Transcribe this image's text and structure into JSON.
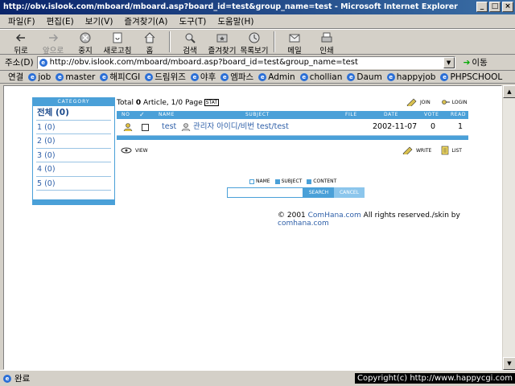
{
  "window": {
    "title": "http://obv.islook.com/mboard/mboard.asp?board_id=test&group_name=test - Microsoft Internet Explorer",
    "min": "_",
    "max": "□",
    "close": "×"
  },
  "menu": [
    "파일(F)",
    "편집(E)",
    "보기(V)",
    "즐겨찾기(A)",
    "도구(T)",
    "도움말(H)"
  ],
  "toolbar": {
    "back": "뒤로",
    "forward": "앞으로",
    "stop": "중지",
    "refresh": "새로고침",
    "home": "홈",
    "search": "검색",
    "favorites": "즐겨찾기",
    "history": "목록보기",
    "mail": "메일",
    "print": "인쇄"
  },
  "address": {
    "label": "주소(D)",
    "url": "http://obv.islook.com/mboard/mboard.asp?board_id=test&group_name=test",
    "go": "이동"
  },
  "links": {
    "label": "연결",
    "items": [
      "job",
      "master",
      "해피CGI",
      "드림위즈",
      "야후",
      "엠파스",
      "Admin",
      "chollian",
      "Daum",
      "happyjob",
      "PHPSCHOOL"
    ]
  },
  "status": {
    "text": "완료"
  },
  "copyright": "Copyright(c) http://www.happycgi.com",
  "category": {
    "header": "CATEGORY",
    "items": [
      "전체 (0)",
      "1 (0)",
      "2 (0)",
      "3 (0)",
      "4 (0)",
      "5 (0)"
    ]
  },
  "board": {
    "total_prefix": "Total ",
    "total_count": "0",
    "total_suffix": " Article, 1/0 Page",
    "stat": "STAT",
    "join": "JOIN",
    "login": "LOGIN",
    "headers": {
      "no": "NO",
      "check": "✓",
      "name": "NAME",
      "subject": "SUBJECT",
      "file": "FILE",
      "date": "DATE",
      "vote": "VOTE",
      "read": "READ"
    },
    "row": {
      "name": "test",
      "subject": "관리자 아이디/비번 test/test",
      "date": "2002-11-07",
      "vote": "0",
      "read": "1"
    },
    "view": "VIEW",
    "write": "WRITE",
    "list": "LIST"
  },
  "search": {
    "opt_name": "NAME",
    "opt_subject": "SUBJECT",
    "opt_content": "CONTENT",
    "search": "SEARCH",
    "cancel": "CANCEL"
  },
  "footer": {
    "prefix": "© 2001 ",
    "comhana": "ComHana.com",
    "middle": " All rights reserved./skin by ",
    "link": "comhana.com"
  }
}
